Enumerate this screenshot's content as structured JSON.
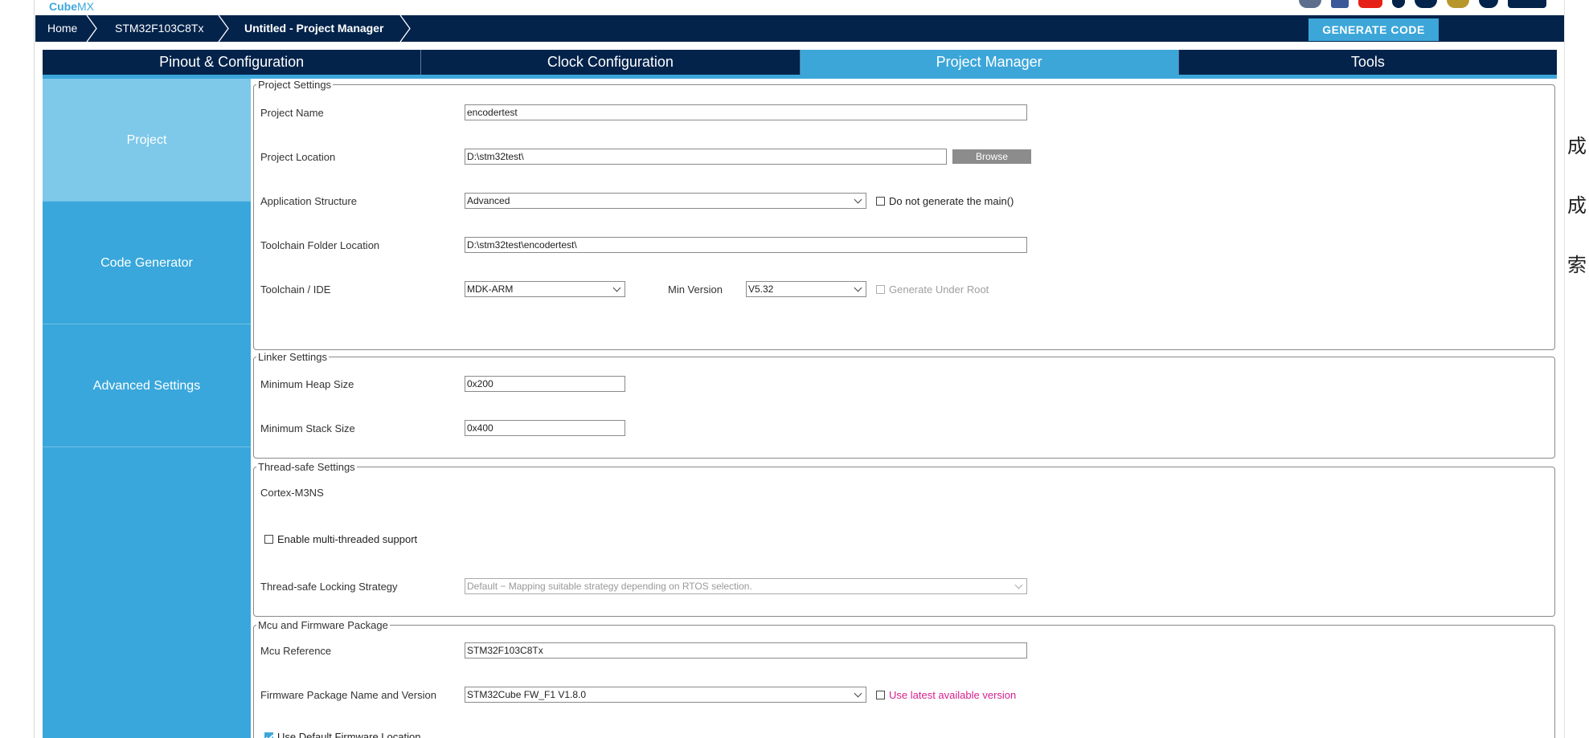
{
  "brand": {
    "name_a": "Cube",
    "name_b": "MX"
  },
  "breadcrumb": {
    "home": "Home",
    "mcu": "STM32F103C8Tx",
    "project": "Untitled - Project Manager"
  },
  "actions": {
    "generate": "GENERATE CODE"
  },
  "tabs": [
    {
      "label": "Pinout & Configuration"
    },
    {
      "label": "Clock Configuration"
    },
    {
      "label": "Project Manager"
    },
    {
      "label": "Tools"
    }
  ],
  "nav": [
    {
      "label": "Project"
    },
    {
      "label": "Code Generator"
    },
    {
      "label": "Advanced Settings"
    }
  ],
  "project_settings": {
    "legend": "Project Settings",
    "name_label": "Project Name",
    "name_value": "encodertest",
    "location_label": "Project Location",
    "location_value": "D:\\stm32test\\",
    "browse": "Browse",
    "app_structure_label": "Application Structure",
    "app_structure_value": "Advanced",
    "no_main_label": "Do not generate the main()",
    "toolchain_folder_label": "Toolchain Folder Location",
    "toolchain_folder_value": "D:\\stm32test\\encodertest\\",
    "toolchain_label": "Toolchain / IDE",
    "toolchain_value": "MDK-ARM",
    "min_version_label": "Min Version",
    "min_version_value": "V5.32",
    "gen_under_root_label": "Generate Under Root"
  },
  "linker": {
    "legend": "Linker Settings",
    "heap_label": "Minimum Heap Size",
    "heap_value": "0x200",
    "stack_label": "Minimum Stack Size",
    "stack_value": "0x400"
  },
  "thread_safe": {
    "legend": "Thread-safe Settings",
    "core": "Cortex-M3NS",
    "multi_label": "Enable multi-threaded support",
    "strategy_label": "Thread-safe Locking Strategy",
    "strategy_value": "Default  −  Mapping suitable strategy depending on RTOS selection."
  },
  "firmware": {
    "legend": "Mcu and Firmware Package",
    "mcu_label": "Mcu Reference",
    "mcu_value": "STM32F103C8Tx",
    "pkg_label": "Firmware Package Name and Version",
    "pkg_value": "STM32Cube FW_F1 V1.8.0",
    "latest_label": "Use latest available version",
    "default_loc_label": "Use Default Firmware Location"
  },
  "side_text": [
    "成",
    "成",
    "索"
  ],
  "colors": {
    "navy": "#03234b",
    "accent": "#3ca6d9",
    "accent_light": "#7ec8ea",
    "pink": "#d6218c"
  }
}
